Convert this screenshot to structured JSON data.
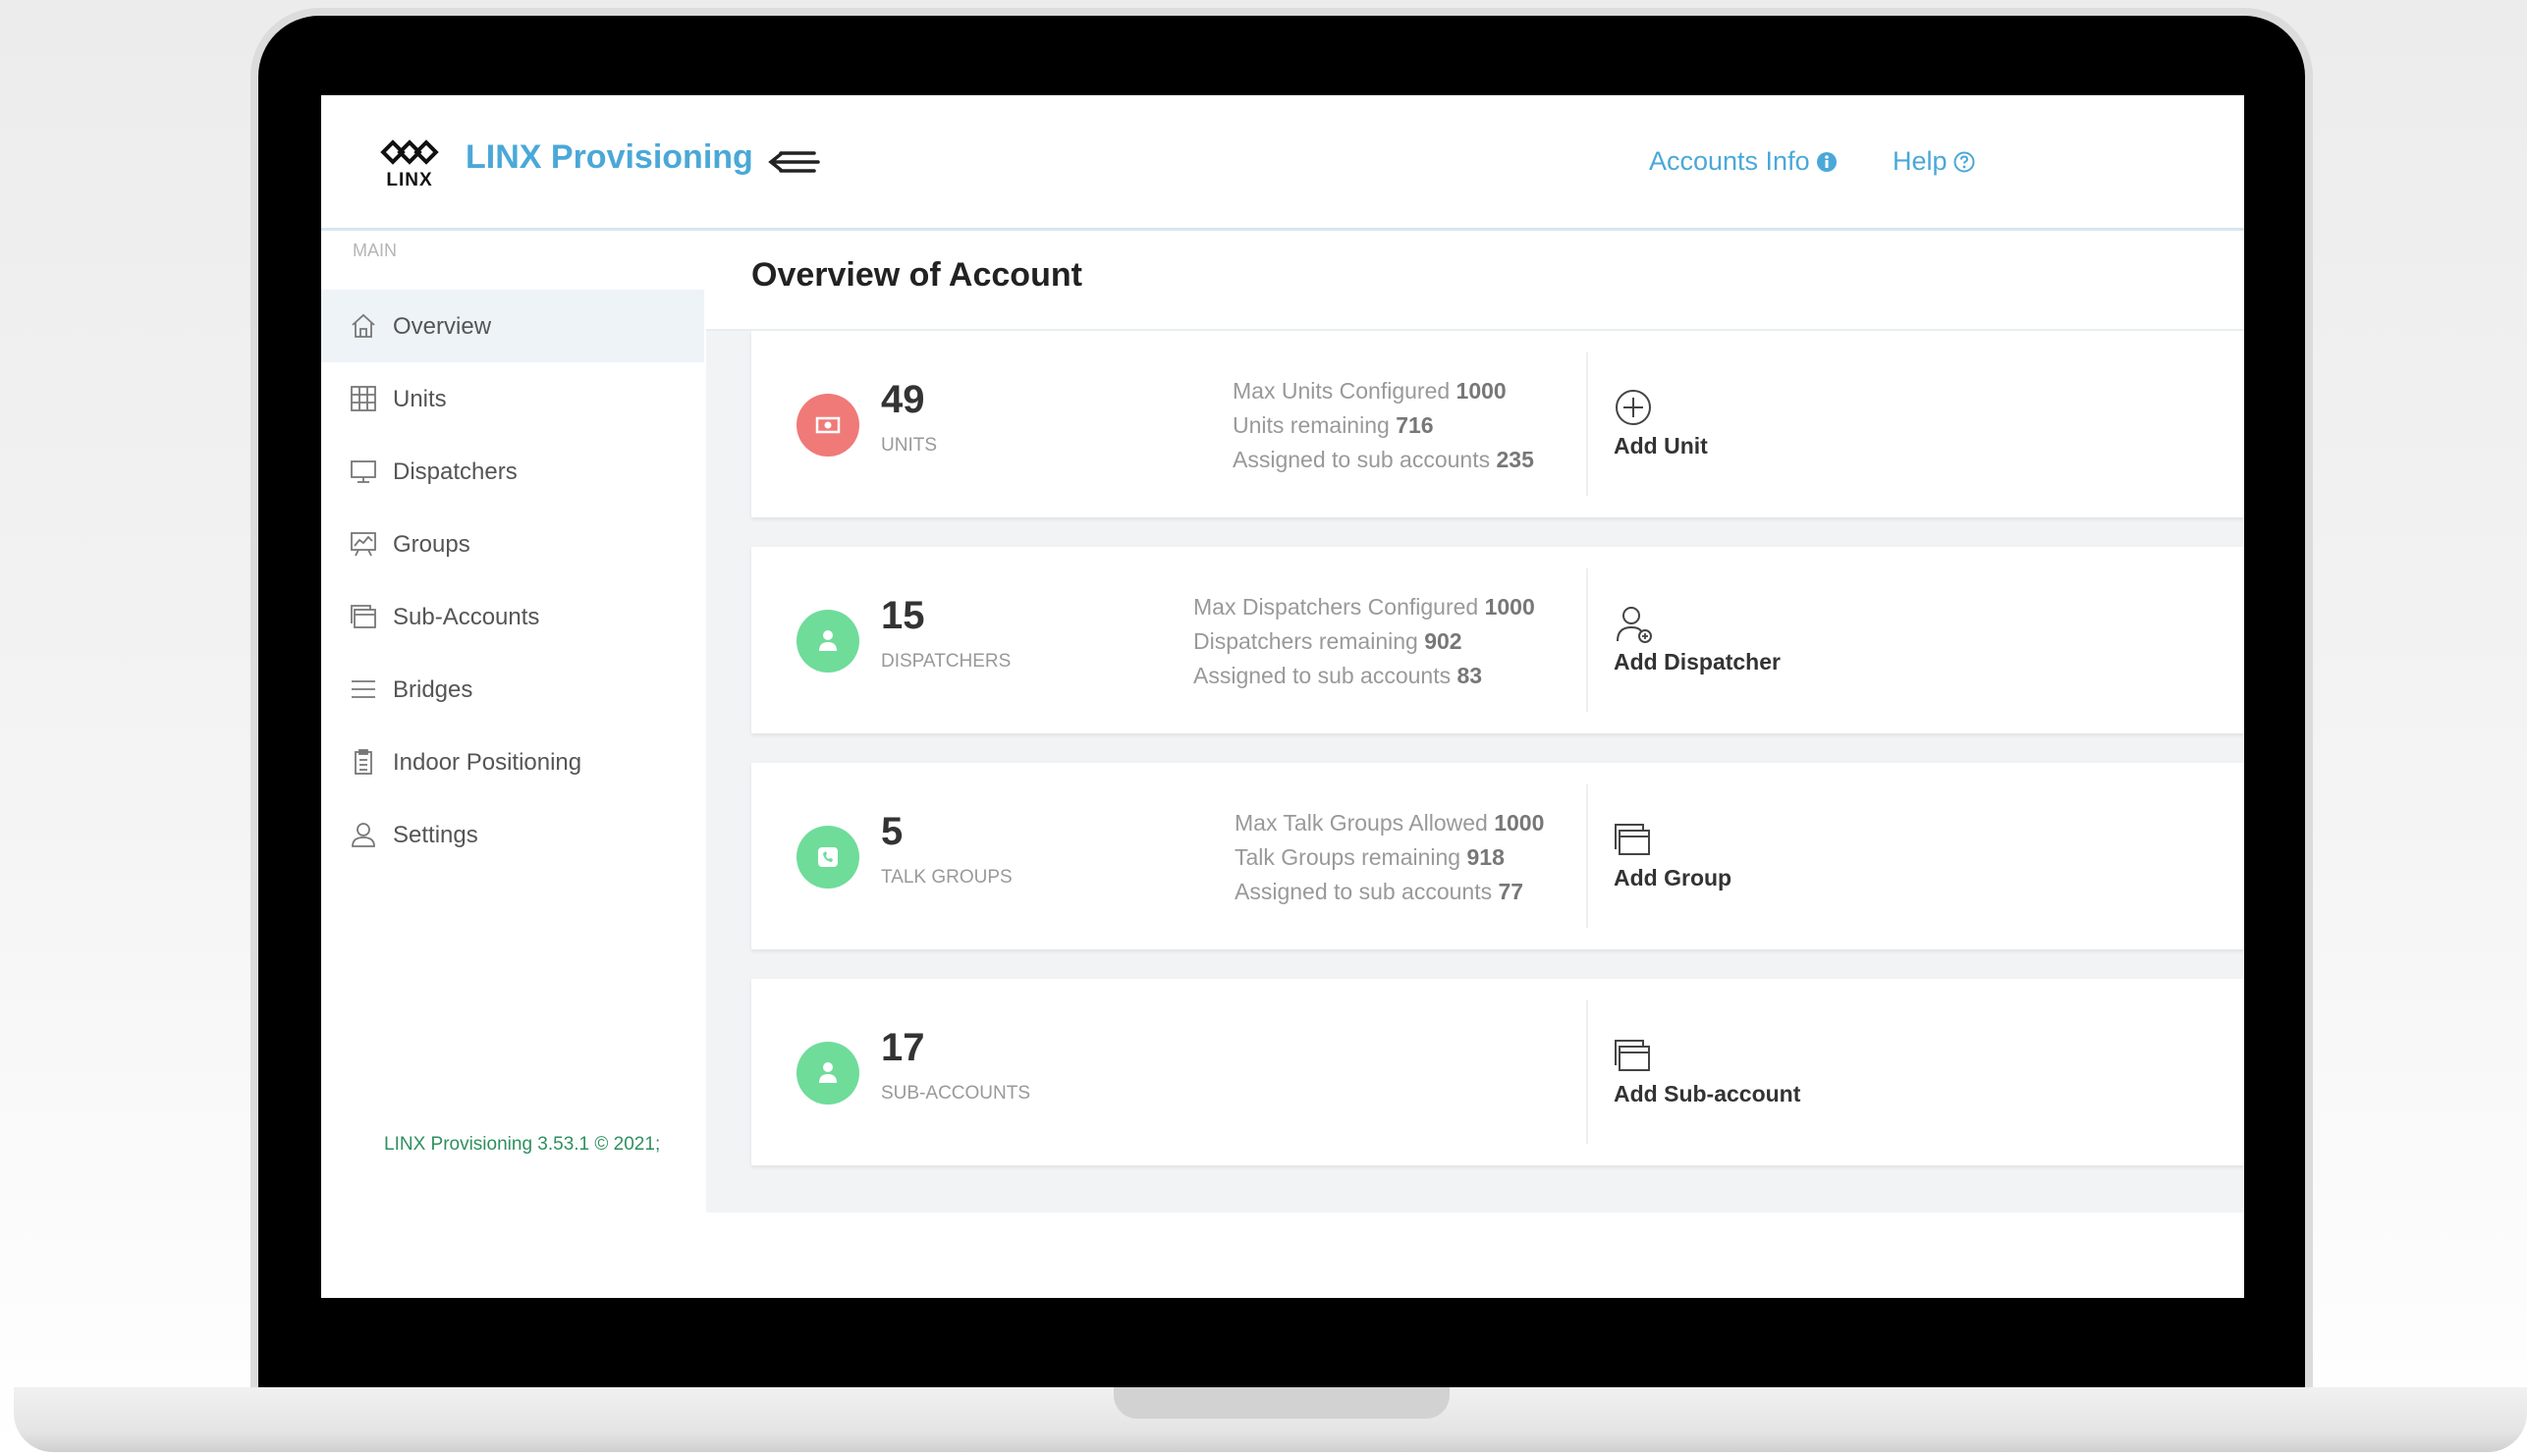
{
  "header": {
    "logo_text": "LINX",
    "brand": "LINX Provisioning",
    "accounts_info": "Accounts Info",
    "help": "Help"
  },
  "sidebar": {
    "section": "MAIN",
    "items": [
      {
        "label": "Overview",
        "icon": "home-icon",
        "active": true
      },
      {
        "label": "Units",
        "icon": "grid-icon"
      },
      {
        "label": "Dispatchers",
        "icon": "monitor-icon"
      },
      {
        "label": "Groups",
        "icon": "presentation-icon"
      },
      {
        "label": "Sub-Accounts",
        "icon": "folder-stack-icon"
      },
      {
        "label": "Bridges",
        "icon": "list-icon"
      },
      {
        "label": "Indoor Positioning",
        "icon": "clipboard-icon"
      },
      {
        "label": "Settings",
        "icon": "user-icon"
      }
    ],
    "footer": "LINX Provisioning 3.53.1 © 2021;"
  },
  "main": {
    "title": "Overview of Account",
    "cards": [
      {
        "number": "49",
        "label": "UNITS",
        "color": "#f07a78",
        "icon": "money-icon",
        "details": [
          {
            "text": "Max Units Configured",
            "value": "1000"
          },
          {
            "text": "Units remaining",
            "value": "716"
          },
          {
            "text": "Assigned to sub accounts",
            "value": "235"
          }
        ],
        "action": "Add Unit",
        "action_icon": "plus-circle-icon"
      },
      {
        "number": "15",
        "label": "DISPATCHERS",
        "color": "#6fdc9a",
        "icon": "dispatcher-icon",
        "details": [
          {
            "text": "Max Dispatchers Configured",
            "value": "1000"
          },
          {
            "text": "Dispatchers remaining",
            "value": "902"
          },
          {
            "text": "Assigned to sub accounts",
            "value": "83"
          }
        ],
        "action": "Add Dispatcher",
        "action_icon": "add-user-icon"
      },
      {
        "number": "5",
        "label": "TALK GROUPS",
        "color": "#6fdc9a",
        "icon": "phone-icon",
        "details": [
          {
            "text": "Max Talk Groups Allowed",
            "value": "1000"
          },
          {
            "text": "Talk Groups remaining",
            "value": "918"
          },
          {
            "text": "Assigned to sub accounts",
            "value": "77"
          }
        ],
        "action": "Add Group",
        "action_icon": "folder-icon"
      },
      {
        "number": "17",
        "label": "SUB-ACCOUNTS",
        "color": "#6fdc9a",
        "icon": "dispatcher-icon",
        "details": [],
        "action": "Add Sub-account",
        "action_icon": "folder-icon"
      }
    ]
  }
}
